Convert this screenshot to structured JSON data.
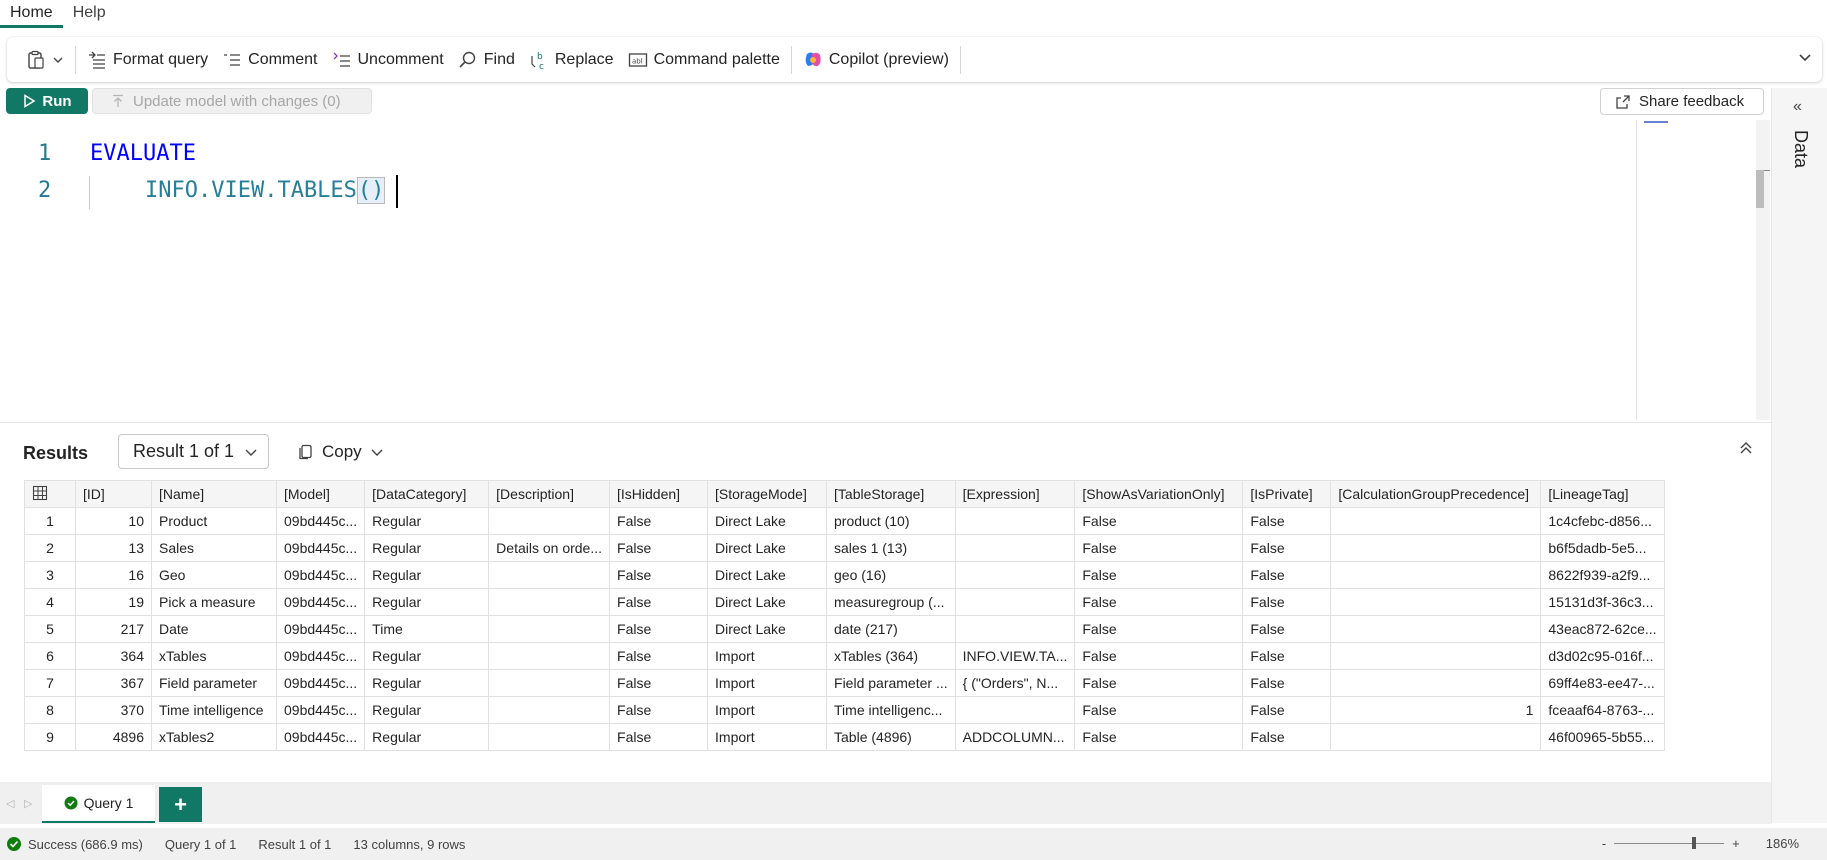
{
  "menu": {
    "tabs": [
      "Home",
      "Help"
    ]
  },
  "ribbon": {
    "format_query": "Format query",
    "comment": "Comment",
    "uncomment": "Uncomment",
    "find": "Find",
    "replace": "Replace",
    "command_palette": "Command palette",
    "copilot": "Copilot (preview)"
  },
  "actions": {
    "run": "Run",
    "update_model": "Update model with changes (0)",
    "share_feedback": "Share feedback"
  },
  "data_pane": {
    "label": "Data"
  },
  "editor": {
    "lines": [
      {
        "num": "1",
        "text": "EVALUATE"
      },
      {
        "num": "2",
        "text": "INFO.VIEW.TABLES"
      }
    ],
    "parens": "()"
  },
  "results": {
    "title": "Results",
    "selector": "Result 1 of 1",
    "copy": "Copy",
    "columns": [
      "[ID]",
      "[Name]",
      "[Model]",
      "[DataCategory]",
      "[Description]",
      "[IsHidden]",
      "[StorageMode]",
      "[TableStorage]",
      "[Expression]",
      "[ShowAsVariationOnly]",
      "[IsPrivate]",
      "[CalculationGroupPrecedence]",
      "[LineageTag]"
    ],
    "rows": [
      [
        "1",
        "10",
        "Product",
        "09bd445c...",
        "Regular",
        "",
        "False",
        "Direct Lake",
        "product (10)",
        "",
        "False",
        "False",
        "",
        "1c4cfebc-d856..."
      ],
      [
        "2",
        "13",
        "Sales",
        "09bd445c...",
        "Regular",
        "Details on orde...",
        "False",
        "Direct Lake",
        "sales 1 (13)",
        "",
        "False",
        "False",
        "",
        "b6f5dadb-5e5..."
      ],
      [
        "3",
        "16",
        "Geo",
        "09bd445c...",
        "Regular",
        "",
        "False",
        "Direct Lake",
        "geo (16)",
        "",
        "False",
        "False",
        "",
        "8622f939-a2f9..."
      ],
      [
        "4",
        "19",
        "Pick a measure",
        "09bd445c...",
        "Regular",
        "",
        "False",
        "Direct Lake",
        "measuregroup (...",
        "",
        "False",
        "False",
        "",
        "15131d3f-36c3..."
      ],
      [
        "5",
        "217",
        "Date",
        "09bd445c...",
        "Time",
        "",
        "False",
        "Direct Lake",
        "date (217)",
        "",
        "False",
        "False",
        "",
        "43eac872-62ce..."
      ],
      [
        "6",
        "364",
        "xTables",
        "09bd445c...",
        "Regular",
        "",
        "False",
        "Import",
        "xTables (364)",
        "INFO.VIEW.TA...",
        "False",
        "False",
        "",
        "d3d02c95-016f..."
      ],
      [
        "7",
        "367",
        "Field parameter",
        "09bd445c...",
        "Regular",
        "",
        "False",
        "Import",
        "Field parameter ...",
        "{ (\"Orders\", N...",
        "False",
        "False",
        "",
        "69ff4e83-ee47-..."
      ],
      [
        "8",
        "370",
        "Time intelligence",
        "09bd445c...",
        "Regular",
        "",
        "False",
        "Import",
        "Time intelligenc...",
        "",
        "False",
        "False",
        "1",
        "fceaaf64-8763-..."
      ],
      [
        "9",
        "4896",
        "xTables2",
        "09bd445c...",
        "Regular",
        "",
        "False",
        "Import",
        "Table (4896)",
        "ADDCOLUMN...",
        "False",
        "False",
        "",
        "46f00965-5b55..."
      ]
    ]
  },
  "tabs": {
    "query_tab": "Query 1",
    "add": "+"
  },
  "status": {
    "success": "Success (686.9 ms)",
    "query": "Query 1 of 1",
    "result": "Result 1 of 1",
    "shape": "13 columns, 9 rows",
    "zoom_minus": "-",
    "zoom_plus": "+",
    "zoom": "186%",
    "zoom_level_percent": 186
  },
  "colors": {
    "accent": "#117865",
    "keyword": "#0000ff",
    "function": "#267f99",
    "line_number": "#237893"
  }
}
